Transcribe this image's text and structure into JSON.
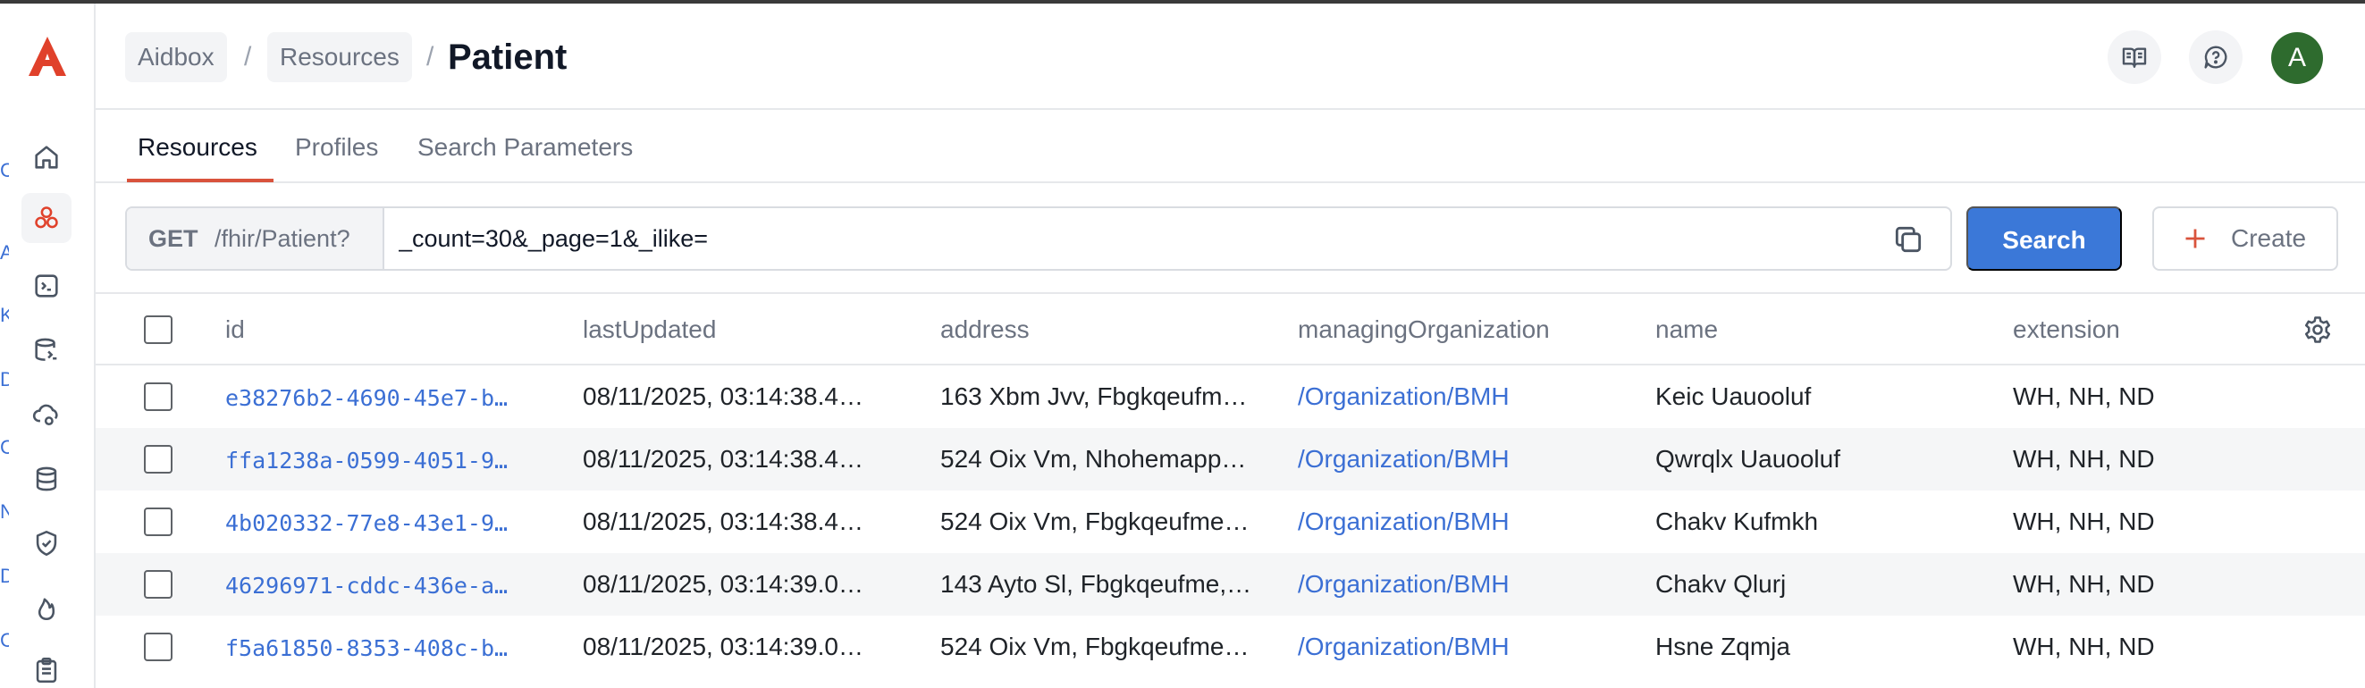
{
  "header": {
    "breadcrumbs": [
      "Aidbox",
      "Resources"
    ],
    "separator": "/",
    "title": "Patient",
    "avatar_initial": "A"
  },
  "sidebar": {
    "items": [
      "home-icon",
      "resources-icon",
      "terminal-icon",
      "db-console-icon",
      "cloud-settings-icon",
      "database-icon",
      "shield-icon",
      "fire-icon",
      "clipboard-icon"
    ],
    "active_item": "resources-icon",
    "edge_fragments": [
      "C",
      "A",
      "K",
      "D",
      "C",
      "N",
      "D",
      "C"
    ]
  },
  "tabs": [
    {
      "label": "Resources",
      "active": true
    },
    {
      "label": "Profiles",
      "active": false
    },
    {
      "label": "Search Parameters",
      "active": false
    }
  ],
  "query": {
    "method": "GET",
    "base_path": "/fhir/Patient?",
    "value": "_count=30&_page=1&_ilike="
  },
  "buttons": {
    "search": "Search",
    "create": "Create"
  },
  "table": {
    "columns": [
      "id",
      "lastUpdated",
      "address",
      "managingOrganization",
      "name",
      "extension"
    ],
    "rows": [
      {
        "id": "e38276b2-4690-45e7-b…",
        "lastUpdated": "08/11/2025, 03:14:38.4…",
        "address": "163 Xbm Jvv, Fbgkqeufm…",
        "managingOrganization": "/Organization/BMH",
        "name": "Keic Uauooluf",
        "extension": "WH, NH, ND"
      },
      {
        "id": "ffa1238a-0599-4051-9…",
        "lastUpdated": "08/11/2025, 03:14:38.4…",
        "address": "524 Oix Vm, Nhohemapp…",
        "managingOrganization": "/Organization/BMH",
        "name": "Qwrqlx Uauooluf",
        "extension": "WH, NH, ND"
      },
      {
        "id": "4b020332-77e8-43e1-9…",
        "lastUpdated": "08/11/2025, 03:14:38.4…",
        "address": "524 Oix Vm, Fbgkqeufme…",
        "managingOrganization": "/Organization/BMH",
        "name": "Chakv Kufmkh",
        "extension": "WH, NH, ND"
      },
      {
        "id": "46296971-cddc-436e-a…",
        "lastUpdated": "08/11/2025, 03:14:39.0…",
        "address": "143 Ayto Sl, Fbgkqeufme,…",
        "managingOrganization": "/Organization/BMH",
        "name": "Chakv Qlurj",
        "extension": "WH, NH, ND"
      },
      {
        "id": "f5a61850-8353-408c-b…",
        "lastUpdated": "08/11/2025, 03:14:39.0…",
        "address": "524 Oix Vm, Fbgkqeufme…",
        "managingOrganization": "/Organization/BMH",
        "name": "Hsne Zqmja",
        "extension": "WH, NH, ND"
      }
    ]
  },
  "colors": {
    "accent": "#d9533c",
    "primary_button": "#3b78d8",
    "link": "#3b6fd4",
    "avatar": "#2e6b2e"
  }
}
